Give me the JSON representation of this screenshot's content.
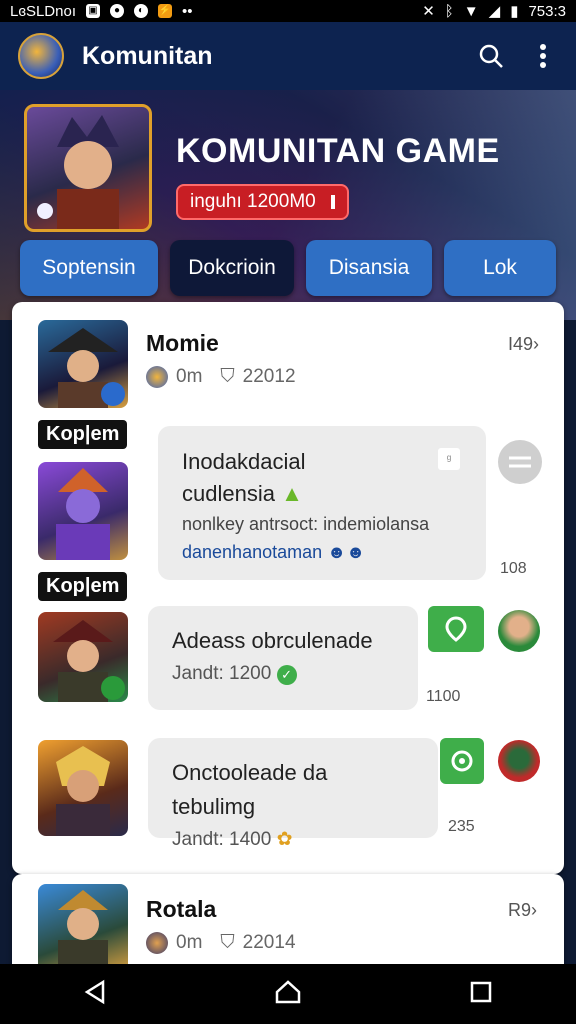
{
  "status": {
    "carrier": "LɞSLDnoı",
    "time": "753:3"
  },
  "appbar": {
    "title": "Komunitan"
  },
  "hero": {
    "title": "KOMUNITAN GAME",
    "badge": "inguhı 1200M0"
  },
  "tabs": [
    {
      "label": "Soptensin"
    },
    {
      "label": "Dokcrioin"
    },
    {
      "label": "Disansia"
    },
    {
      "label": "Lok"
    }
  ],
  "post1": {
    "author": "Momie",
    "meta_a": "0m",
    "meta_b": "22012",
    "corner": "I49›",
    "labels": [
      "Kop|em",
      "Kop|em"
    ],
    "reply1": {
      "line1": "Inodakdacial",
      "line2": "cudlensia",
      "line3": "nonlkey antrsoct: indemiolansa",
      "line4": "danenhanotaman",
      "count": "108"
    },
    "reply2": {
      "title": "Adeass obrculenade",
      "sub": "Jandt: 1200",
      "count": "1100"
    },
    "reply3": {
      "title": "Onctooleade da tebulimg",
      "sub": "Jandt: 1400",
      "count": "235"
    }
  },
  "post2": {
    "author": "Rotala",
    "meta_a": "0m",
    "meta_b": "22014",
    "corner": "R9›"
  },
  "colors": {
    "appbar": "#0d2350",
    "tab": "#2f6fc4",
    "tab_active": "#0e1838",
    "badge": "#c81e24",
    "green": "#3fae4a"
  }
}
